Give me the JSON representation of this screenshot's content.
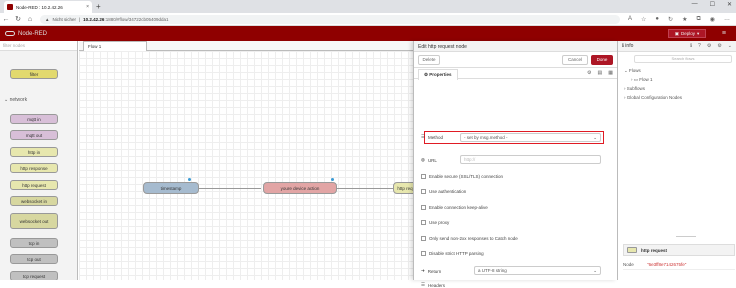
{
  "browser": {
    "tab_title": "Node-RED : 10.2.42.26",
    "tab_close": "×",
    "new_tab": "+",
    "security": "Nicht sicher",
    "url_host": "10.2.42.26",
    "url_path": ":1880/#flow/34722cb05409dda1",
    "window_controls": [
      "—",
      "☐",
      "✕"
    ]
  },
  "nodered": {
    "app_title": "Node-RED",
    "deploy_label": "Deploy",
    "brand_color": "#8f0000"
  },
  "palette": {
    "filter_placeholder": "filter nodes",
    "category": "network",
    "nodes": [
      "filter",
      "mqtt in",
      "mqtt out",
      "http in",
      "http response",
      "http request",
      "websocket in",
      "websocket out",
      "tcp in",
      "tcp out",
      "tcp request"
    ]
  },
  "workspace": {
    "flow_tab": "Flow 1",
    "nodes": [
      "timestamp",
      "youre device action",
      "http req"
    ]
  },
  "tray": {
    "title": "Edit http request node",
    "delete": "Delete",
    "cancel": "Cancel",
    "done": "Done",
    "properties_tab": "Properties",
    "method_label": "Method",
    "method_value": "- set by msg.method -",
    "url_label": "URL",
    "url_placeholder": "http://",
    "checkboxes": [
      "Enable secure (SSL/TLS) connection",
      "Use authentication",
      "Enable connection keep-alive",
      "Use proxy",
      "Only send non-2xx responses to Catch node",
      "Disable strict HTTP parsing"
    ],
    "return_label": "Return",
    "return_value": "a UTF-8 string",
    "headers_label": "Headers"
  },
  "sidebar": {
    "tab_label": "info",
    "search_placeholder": "Search flows",
    "tree": [
      "Flows",
      "Flow 1",
      "Subflows",
      "Global Configuration Nodes"
    ],
    "node_title": "http request",
    "info_key": "Node",
    "info_value": "\"6e3ff8e7142675fe\""
  }
}
